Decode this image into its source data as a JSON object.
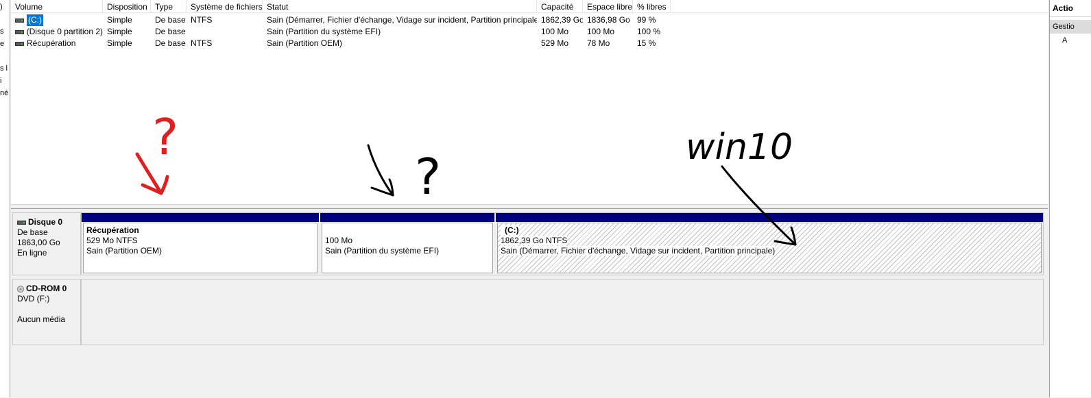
{
  "left_pane": {
    "fragments": [
      ")",
      "s",
      "e",
      "s l",
      "i",
      "né"
    ]
  },
  "volume_table": {
    "columns": [
      "Volume",
      "Disposition",
      "Type",
      "Système de fichiers",
      "Statut",
      "Capacité",
      "Espace libre",
      "% libres"
    ],
    "rows": [
      {
        "volume": "(C:)",
        "disposition": "Simple",
        "type": "De base",
        "fs": "NTFS",
        "statut": "Sain (Démarrer, Fichier d'échange, Vidage sur incident, Partition principale)",
        "capacite": "1862,39 Go",
        "libre": "1836,98 Go",
        "pct": "99 %",
        "selected": true
      },
      {
        "volume": "(Disque 0 partition 2)",
        "disposition": "Simple",
        "type": "De base",
        "fs": "",
        "statut": "Sain (Partition du système EFI)",
        "capacite": "100 Mo",
        "libre": "100 Mo",
        "pct": "100 %"
      },
      {
        "volume": "Récupération",
        "disposition": "Simple",
        "type": "De base",
        "fs": "NTFS",
        "statut": "Sain (Partition OEM)",
        "capacite": "529 Mo",
        "libre": "78 Mo",
        "pct": "15 %"
      }
    ]
  },
  "disk0": {
    "title": "Disque 0",
    "kind": "De base",
    "size": "1863,00 Go",
    "state": "En ligne",
    "partitions": [
      {
        "name": "Récupération",
        "size": "529 Mo NTFS",
        "status": "Sain (Partition OEM)"
      },
      {
        "name": "",
        "size": "100 Mo",
        "status": "Sain (Partition du système EFI)"
      },
      {
        "name": "(C:)",
        "size": "1862,39 Go NTFS",
        "status": "Sain (Démarrer, Fichier d'échange, Vidage sur incident, Partition principale)"
      }
    ]
  },
  "cdrom0": {
    "title": "CD-ROM 0",
    "drive": "DVD (F:)",
    "media": "Aucun média"
  },
  "actions_pane": {
    "title": "Actio",
    "item": "Gestio",
    "sub": "A"
  },
  "annotations": {
    "red_question": "?",
    "black_question": "?",
    "win_label": "win10",
    "colors": {
      "red": "#e02020",
      "black": "#000000"
    }
  },
  "colors": {
    "partition_bar": "#00007f",
    "selection": "#0078d7"
  }
}
